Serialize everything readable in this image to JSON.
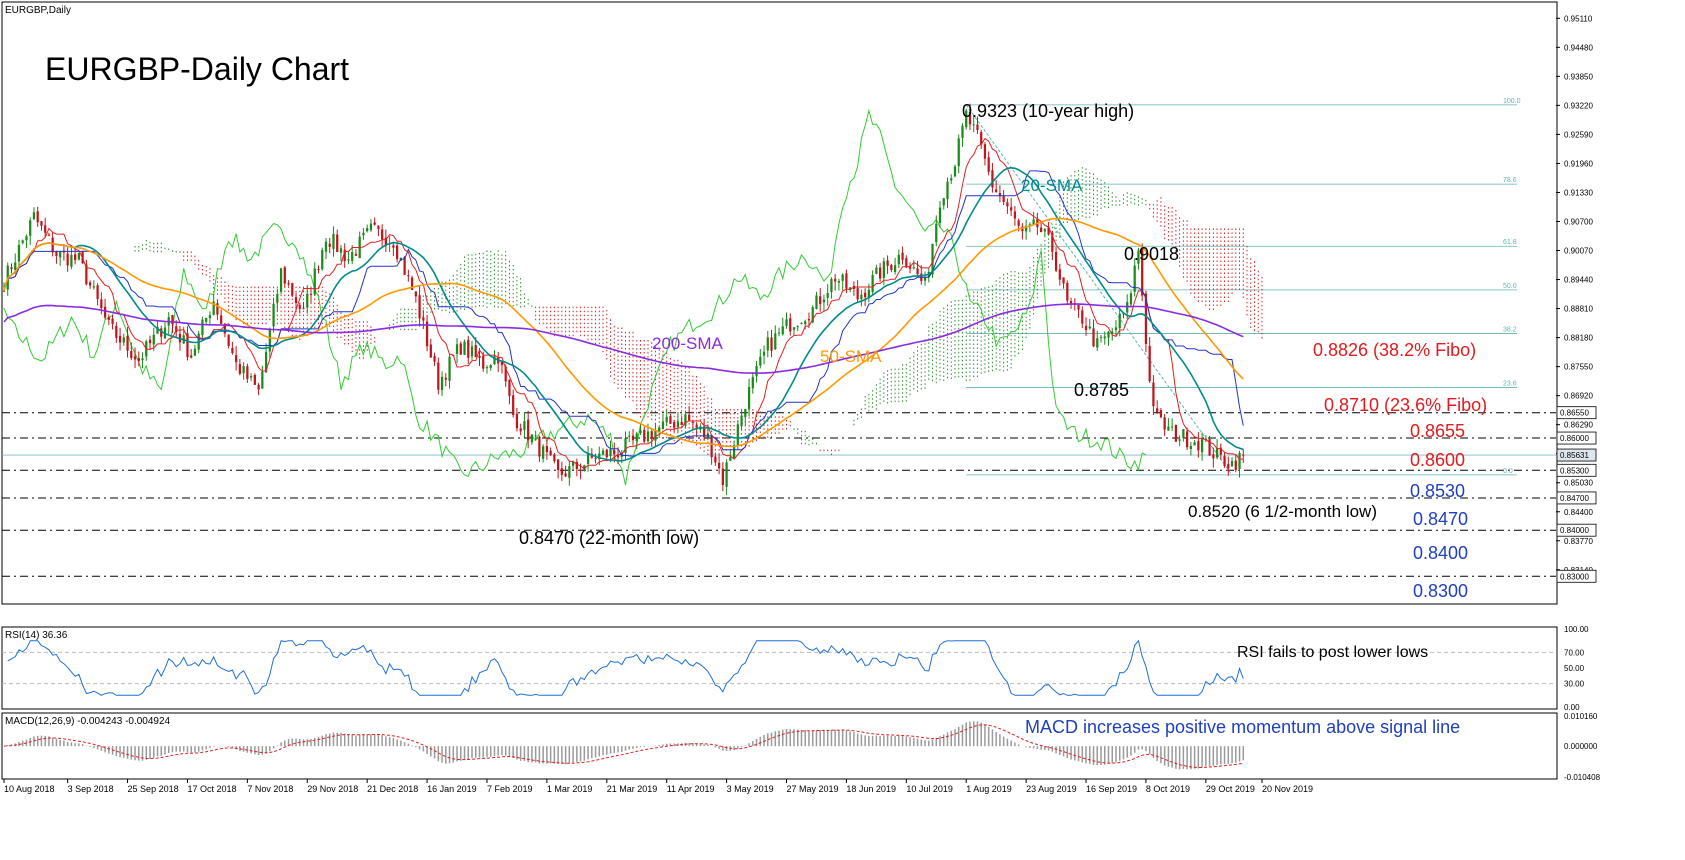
{
  "window": {
    "symbol_label": "EURGBP,Daily"
  },
  "chart_data": {
    "type": "candlestick",
    "title": "EURGBP-Daily Chart",
    "price_axis": {
      "range": [
        0.8242,
        0.9542
      ],
      "ticks": [
        "0.95110",
        "0.94480",
        "0.93850",
        "0.93220",
        "0.92590",
        "0.91960",
        "0.91330",
        "0.90700",
        "0.90070",
        "0.89440",
        "0.88810",
        "0.88180",
        "0.87550",
        "0.86920",
        "0.86290",
        "0.85660",
        "0.85030",
        "0.84400",
        "0.83770",
        "0.83140"
      ],
      "markers": [
        {
          "value": 0.8655,
          "label": "0.86550"
        },
        {
          "value": 0.86,
          "label": "0.86000"
        },
        {
          "value": 0.85631,
          "label": "0.85631"
        },
        {
          "value": 0.853,
          "label": "0.85300"
        },
        {
          "value": 0.847,
          "label": "0.84700"
        },
        {
          "value": 0.84,
          "label": "0.84000"
        },
        {
          "value": 0.83,
          "label": "0.83000"
        }
      ]
    },
    "x_axis": {
      "total_bars": 336,
      "labels": [
        {
          "bar": 0,
          "text": "10 Aug 2018"
        },
        {
          "bar": 17,
          "text": "3 Sep 2018"
        },
        {
          "bar": 33,
          "text": "25 Sep 2018"
        },
        {
          "bar": 49,
          "text": "17 Oct 2018"
        },
        {
          "bar": 65,
          "text": "7 Nov 2018"
        },
        {
          "bar": 81,
          "text": "29 Nov 2018"
        },
        {
          "bar": 97,
          "text": "21 Dec 2018"
        },
        {
          "bar": 113,
          "text": "16 Jan 2019"
        },
        {
          "bar": 129,
          "text": "7 Feb 2019"
        },
        {
          "bar": 145,
          "text": "1 Mar 2019"
        },
        {
          "bar": 161,
          "text": "21 Mar 2019"
        },
        {
          "bar": 177,
          "text": "11 Apr 2019"
        },
        {
          "bar": 193,
          "text": "3 May 2019"
        },
        {
          "bar": 209,
          "text": "27 May 2019"
        },
        {
          "bar": 225,
          "text": "18 Jun 2019"
        },
        {
          "bar": 241,
          "text": "10 Jul 2019"
        },
        {
          "bar": 257,
          "text": "1 Aug 2019"
        },
        {
          "bar": 273,
          "text": "23 Aug 2019"
        },
        {
          "bar": 289,
          "text": "16 Sep 2019"
        },
        {
          "bar": 305,
          "text": "8 Oct 2019"
        },
        {
          "bar": 321,
          "text": "29 Oct 2019"
        },
        {
          "bar": 336,
          "text": "20 Nov 2019"
        }
      ]
    },
    "price_keypoints": [
      [
        0,
        0.894
      ],
      [
        8,
        0.908
      ],
      [
        14,
        0.9
      ],
      [
        20,
        0.8985
      ],
      [
        28,
        0.884
      ],
      [
        36,
        0.877
      ],
      [
        44,
        0.886
      ],
      [
        50,
        0.878
      ],
      [
        56,
        0.89
      ],
      [
        62,
        0.876
      ],
      [
        68,
        0.87
      ],
      [
        74,
        0.896
      ],
      [
        80,
        0.887
      ],
      [
        86,
        0.904
      ],
      [
        92,
        0.899
      ],
      [
        98,
        0.905
      ],
      [
        104,
        0.903
      ],
      [
        110,
        0.89
      ],
      [
        116,
        0.872
      ],
      [
        122,
        0.88
      ],
      [
        128,
        0.876
      ],
      [
        132,
        0.878
      ],
      [
        136,
        0.865
      ],
      [
        142,
        0.859
      ],
      [
        148,
        0.852
      ],
      [
        154,
        0.854
      ],
      [
        158,
        0.856
      ],
      [
        164,
        0.857
      ],
      [
        170,
        0.86
      ],
      [
        176,
        0.8625
      ],
      [
        182,
        0.8645
      ],
      [
        188,
        0.86
      ],
      [
        192,
        0.851
      ],
      [
        198,
        0.868
      ],
      [
        204,
        0.88
      ],
      [
        210,
        0.885
      ],
      [
        216,
        0.888
      ],
      [
        222,
        0.895
      ],
      [
        228,
        0.8905
      ],
      [
        234,
        0.896
      ],
      [
        240,
        0.9
      ],
      [
        246,
        0.893
      ],
      [
        250,
        0.912
      ],
      [
        254,
        0.92
      ],
      [
        257,
        0.93
      ],
      [
        260,
        0.925
      ],
      [
        264,
        0.915
      ],
      [
        268,
        0.91
      ],
      [
        272,
        0.904
      ],
      [
        276,
        0.906
      ],
      [
        280,
        0.901
      ],
      [
        284,
        0.889
      ],
      [
        288,
        0.886
      ],
      [
        292,
        0.88
      ],
      [
        296,
        0.883
      ],
      [
        300,
        0.888
      ],
      [
        303,
        0.901
      ],
      [
        306,
        0.872
      ],
      [
        308,
        0.864
      ],
      [
        312,
        0.861
      ],
      [
        316,
        0.86
      ],
      [
        320,
        0.859
      ],
      [
        324,
        0.856
      ],
      [
        328,
        0.8545
      ],
      [
        331,
        0.856
      ]
    ],
    "sma_series": [
      {
        "name": "20-SMA",
        "color": "#008b8b",
        "period": 20
      },
      {
        "name": "50-SMA",
        "color": "#ff9900",
        "period": 50
      },
      {
        "name": "200-SMA",
        "color": "#8a2be2",
        "period": 200
      }
    ],
    "fibonacci": {
      "high": 0.9323,
      "low": 0.852,
      "levels": [
        "100.0",
        "78.6",
        "61.8",
        "50.0",
        "38.2",
        "23.6",
        "0.0"
      ]
    },
    "annotations": {
      "high_label": "0.9323 (10-year high)",
      "sma20_label": "20-SMA",
      "level_9018": "0.9018",
      "sma200_label": "200-SMA",
      "sma50_label": "50-SMA",
      "fibo382_label": "0.8826 (38.2% Fibo)",
      "level_8785": "0.8785",
      "fibo236_label": "0.8710 (23.6% Fibo)",
      "level_8655": "0.8655",
      "level_8600": "0.8600",
      "level_8530": "0.8530",
      "low_6m_label": "0.8520 (6 1/2-month low)",
      "level_8470": "0.8470",
      "low_22m_label": "0.8470 (22-month low)",
      "level_8400": "0.8400",
      "level_8300": "0.8300"
    },
    "rsi": {
      "label": "RSI(14) 36.36",
      "value": 36.36,
      "ticks": [
        "100.00",
        "70.00",
        "50.00",
        "30.00",
        "0.00"
      ],
      "note": "RSI fails to post lower lows"
    },
    "macd": {
      "label": "MACD(12,26,9) -0.004243 -0.004924",
      "main": -0.004243,
      "signal": -0.004924,
      "ticks": [
        "0.010160",
        "0.000000",
        "-0.010408"
      ],
      "note": "MACD increases positive momentum above signal line"
    }
  }
}
